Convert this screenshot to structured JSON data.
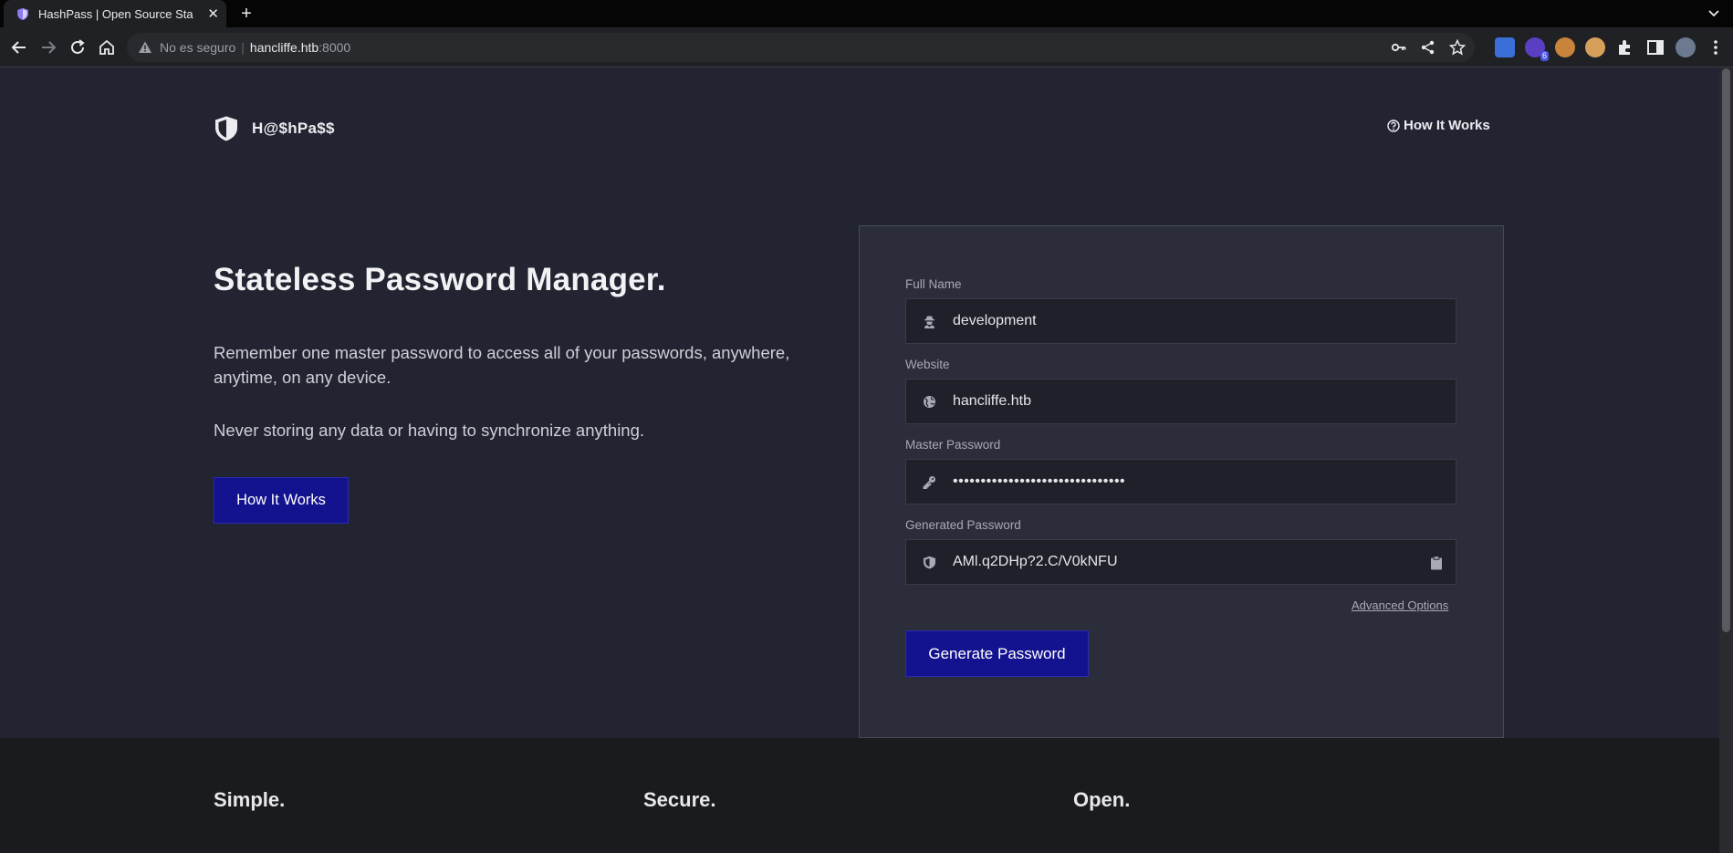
{
  "browser": {
    "tab_title": "HashPass | Open Source Sta",
    "new_tab": "+",
    "security_label": "No es seguro",
    "separator": "|",
    "host": "hancliffe.htb",
    "port": ":8000",
    "extension_badge": "6"
  },
  "nav": {
    "brand": "H@$hPa$$",
    "how_it_works": "How It Works"
  },
  "hero": {
    "headline": "Stateless Password Manager.",
    "paragraph1": "Remember one master password to access all of your passwords, anywhere, anytime, on any device.",
    "paragraph2": "Never storing any data or having to synchronize anything.",
    "cta": "How It Works"
  },
  "form": {
    "full_name_label": "Full Name",
    "full_name_value": "development",
    "website_label": "Website",
    "website_value": "hancliffe.htb",
    "master_label": "Master Password",
    "master_value": "•••••••••••••••••••••••••••••••",
    "generated_label": "Generated Password",
    "generated_value": "AMl.q2DHp?2.C/V0kNFU",
    "advanced_link": "Advanced Options",
    "generate_button": "Generate Password"
  },
  "features": {
    "simple": "Simple.",
    "secure": "Secure.",
    "open": "Open."
  },
  "colors": {
    "accent": "#14138f",
    "background": "#222431",
    "card": "#2b2d3a",
    "footer": "#1a1b1e"
  }
}
